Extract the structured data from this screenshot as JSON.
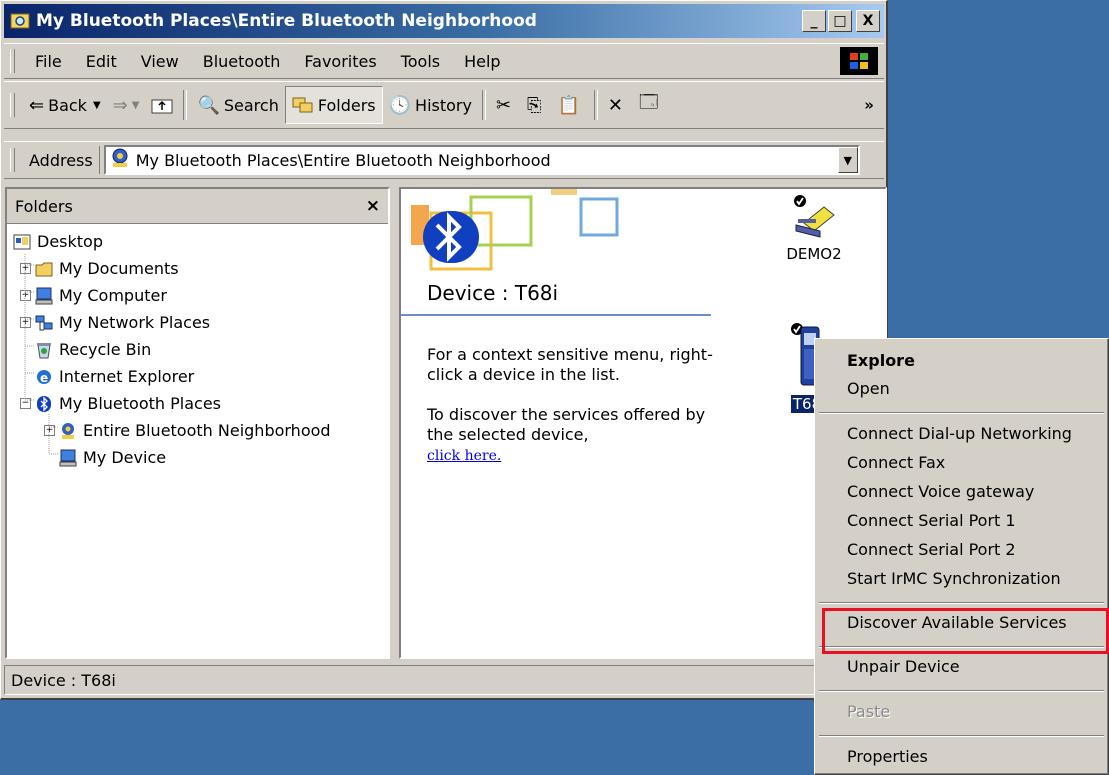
{
  "window": {
    "title": "My Bluetooth Places\\Entire Bluetooth Neighborhood",
    "minimize": "_",
    "maximize": "□",
    "close": "X"
  },
  "menubar": [
    "File",
    "Edit",
    "View",
    "Bluetooth",
    "Favorites",
    "Tools",
    "Help"
  ],
  "toolbar": {
    "back": "Back",
    "search": "Search",
    "folders": "Folders",
    "history": "History",
    "more": "»"
  },
  "address": {
    "label": "Address",
    "value": "My Bluetooth Places\\Entire Bluetooth Neighborhood"
  },
  "folders_pane": {
    "header": "Folders",
    "close": "×",
    "tree": [
      {
        "label": "Desktop",
        "icon": "desktop-icon"
      },
      {
        "label": "My Documents",
        "icon": "folder-icon"
      },
      {
        "label": "My Computer",
        "icon": "computer-icon"
      },
      {
        "label": "My Network Places",
        "icon": "network-icon"
      },
      {
        "label": "Recycle Bin",
        "icon": "recycle-bin-icon"
      },
      {
        "label": "Internet Explorer",
        "icon": "ie-icon"
      },
      {
        "label": "My Bluetooth Places",
        "icon": "bluetooth-icon"
      },
      {
        "label": "Entire Bluetooth Neighborhood",
        "icon": "neighborhood-icon"
      },
      {
        "label": "My Device",
        "icon": "device-icon"
      }
    ]
  },
  "content": {
    "device_title": "Device : T68i",
    "hint1": "For a context sensitive menu, right-click a device in the list.",
    "hint2": "To discover the services offered by the selected device,",
    "link": "click here.",
    "devices": [
      {
        "label": "DEMO2",
        "icon": "laptop-icon"
      },
      {
        "label": "T68",
        "icon": "phone-icon"
      }
    ]
  },
  "status": {
    "text": "Device : T68i"
  },
  "context_menu": {
    "items": [
      {
        "label": "Explore",
        "style": "bold"
      },
      {
        "label": "Open"
      },
      {
        "label": "Connect Dial-up Networking"
      },
      {
        "label": "Connect Fax"
      },
      {
        "label": "Connect Voice gateway"
      },
      {
        "label": "Connect Serial Port 1"
      },
      {
        "label": "Connect Serial Port 2"
      },
      {
        "label": "Start IrMC Synchronization"
      },
      {
        "label": "Discover Available Services",
        "highlighted": true
      },
      {
        "label": "Unpair Device"
      },
      {
        "label": "Paste",
        "style": "disabled"
      },
      {
        "label": "Properties"
      }
    ]
  },
  "colors": {
    "title_gradient_start": "#0a246a",
    "title_gradient_end": "#a6caf0",
    "face": "#d4d0c8",
    "desktop": "#3a6ea5",
    "highlight_box": "#e81123",
    "link": "#0000ee"
  }
}
